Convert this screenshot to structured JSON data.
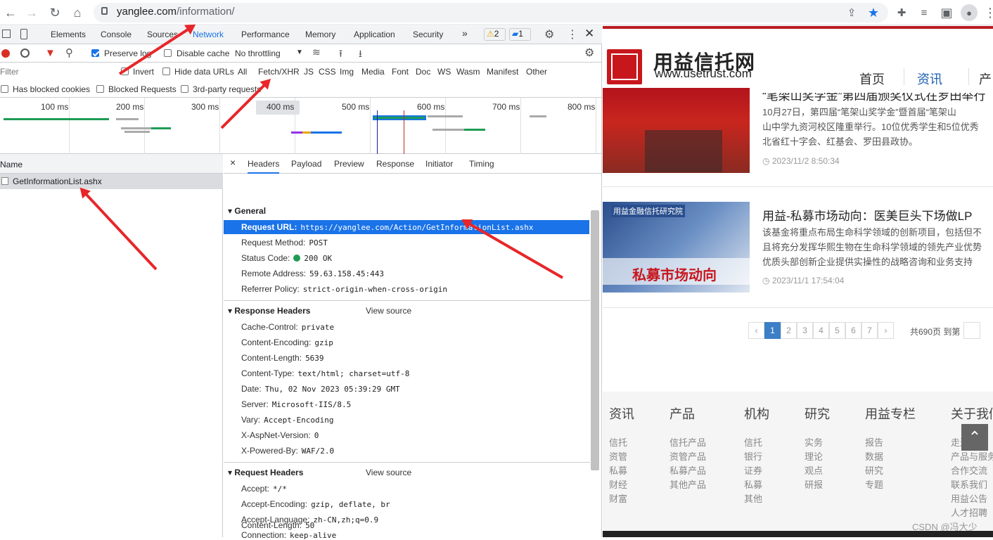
{
  "browser": {
    "url_host": "yanglee.com",
    "url_path": "/information/"
  },
  "devtools": {
    "tabs": [
      "Elements",
      "Console",
      "Sources",
      "Network",
      "Performance",
      "Memory",
      "Application",
      "Security"
    ],
    "active_tab": "Network",
    "more_tabs": "»",
    "warnings_count": "2",
    "messages_count": "1",
    "toolbar": {
      "preserve_log": "Preserve log",
      "disable_cache": "Disable cache",
      "throttling": "No throttling"
    },
    "filter_bar": {
      "placeholder": "Filter",
      "invert": "Invert",
      "hide_data_urls": "Hide data URLs",
      "types": [
        "All",
        "Fetch/XHR",
        "JS",
        "CSS",
        "Img",
        "Media",
        "Font",
        "Doc",
        "WS",
        "Wasm",
        "Manifest",
        "Other"
      ],
      "active_type": "Fetch/XHR"
    },
    "blocked_bar": {
      "has_blocked_cookies": "Has blocked cookies",
      "blocked_requests": "Blocked Requests",
      "third_party": "3rd-party requests"
    },
    "overview_ticks": [
      "100 ms",
      "200 ms",
      "300 ms",
      "400 ms",
      "500 ms",
      "600 ms",
      "700 ms",
      "800 ms"
    ],
    "requests": {
      "column_name": "Name",
      "items": [
        "GetInformationList.ashx"
      ]
    },
    "details": {
      "tabs": [
        "Headers",
        "Payload",
        "Preview",
        "Response",
        "Initiator",
        "Timing"
      ],
      "active_tab": "Headers",
      "close": "×",
      "general": {
        "title": "General",
        "rows": [
          {
            "k": "Request URL:",
            "v": "https://yanglee.com/Action/GetInformationList.ashx"
          },
          {
            "k": "Request Method:",
            "v": "POST"
          },
          {
            "k": "Status Code:",
            "v": "200 OK"
          },
          {
            "k": "Remote Address:",
            "v": "59.63.158.45:443"
          },
          {
            "k": "Referrer Policy:",
            "v": "strict-origin-when-cross-origin"
          }
        ]
      },
      "response_headers": {
        "title": "Response Headers",
        "view_source": "View source",
        "rows": [
          {
            "k": "Cache-Control:",
            "v": "private"
          },
          {
            "k": "Content-Encoding:",
            "v": "gzip"
          },
          {
            "k": "Content-Length:",
            "v": "5639"
          },
          {
            "k": "Content-Type:",
            "v": "text/html; charset=utf-8"
          },
          {
            "k": "Date:",
            "v": "Thu, 02 Nov 2023 05:39:29 GMT"
          },
          {
            "k": "Server:",
            "v": "Microsoft-IIS/8.5"
          },
          {
            "k": "Vary:",
            "v": "Accept-Encoding"
          },
          {
            "k": "X-AspNet-Version:",
            "v": "0"
          },
          {
            "k": "X-Powered-By:",
            "v": "WAF/2.0"
          }
        ]
      },
      "request_headers": {
        "title": "Request Headers",
        "view_source": "View source",
        "rows": [
          {
            "k": "Accept:",
            "v": "*/*"
          },
          {
            "k": "Accept-Encoding:",
            "v": "gzip, deflate, br"
          },
          {
            "k": "Accept-Language:",
            "v": "zh-CN,zh;q=0.9"
          },
          {
            "k": "Connection:",
            "v": "keep-alive"
          },
          {
            "k": "Content-Length:",
            "v": "50"
          }
        ]
      }
    }
  },
  "site": {
    "logo_cn": "用益信托网",
    "logo_en": "www.usetrust.com",
    "nav": [
      "首页",
      "资讯",
      "产"
    ],
    "nav_active": "资讯",
    "news": [
      {
        "title": "“笔架山奖学金”第四届颁奖仪式在罗田举行",
        "desc": [
          "10月27日，第四届“笔架山奖学金”暨首届“笔架山",
          "山中学九资河校区隆重举行。10位优秀学生和5位优秀",
          "北省红十字会、红基会、罗田县政协。"
        ],
        "time": "2023/11/2 8:50:34",
        "image_caption": ""
      },
      {
        "title": "用益-私募市场动向：医美巨头下场做LP",
        "desc": [
          "该基金将重点布局生命科学领域的创新项目，包括但不",
          "且将充分发挥华熙生物在生命科学领域的领先产业优势",
          "优质头部创新企业提供实操性的战略咨询和业务支持"
        ],
        "time": "2023/11/1 17:54:04",
        "image_caption": "私募市场动向",
        "image_brand": "用益金融信托研究院"
      }
    ],
    "pagination": {
      "prev": "‹",
      "pages": [
        "1",
        "2",
        "3",
        "4",
        "5",
        "6",
        "7"
      ],
      "next": "›",
      "active": "1",
      "total_text": "共690页 到第"
    },
    "footer": {
      "columns": [
        {
          "h": "资讯",
          "items": [
            "信托",
            "资管",
            "私募",
            "财经",
            "财富"
          ]
        },
        {
          "h": "产品",
          "items": [
            "信托产品",
            "资管产品",
            "私募产品",
            "其他产品"
          ]
        },
        {
          "h": "机构",
          "items": [
            "信托",
            "银行",
            "证券",
            "私募",
            "其他"
          ]
        },
        {
          "h": "研究",
          "items": [
            "实务",
            "理论",
            "观点",
            "研报"
          ]
        },
        {
          "h": "用益专栏",
          "items": [
            "报告",
            "数据",
            "研究",
            "专题"
          ]
        },
        {
          "h": "关于我们",
          "items": [
            "走进用益",
            "产品与服务",
            "合作交流",
            "联系我们",
            "用益公告",
            "人才招聘"
          ]
        }
      ],
      "watermark": "CSDN @冯大少"
    }
  }
}
